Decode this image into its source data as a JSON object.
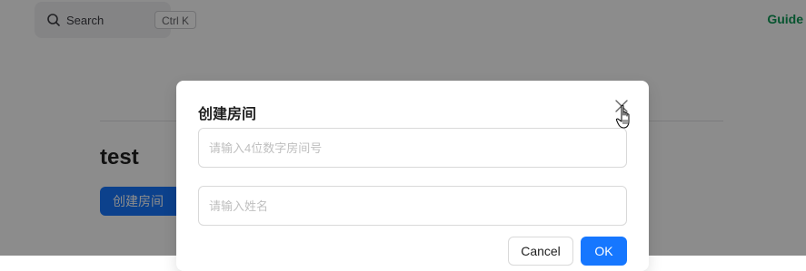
{
  "search": {
    "label": "Search",
    "shortcut": "Ctrl K"
  },
  "nav": {
    "guide_label": "Guide"
  },
  "page": {
    "heading": "test",
    "create_button_label": "创建房间"
  },
  "modal": {
    "title": "创建房间",
    "room_input": {
      "placeholder": "请输入4位数字房间号",
      "value": ""
    },
    "name_input": {
      "placeholder": "请输入姓名",
      "value": ""
    },
    "cancel_label": "Cancel",
    "ok_label": "OK"
  },
  "icons": {
    "search": "search-icon",
    "close": "close-icon",
    "cursor": "hand-pointer-icon"
  },
  "colors": {
    "primary": "#1677ff",
    "guide": "#0e9a57",
    "mask": "rgba(0,0,0,0.45)"
  }
}
